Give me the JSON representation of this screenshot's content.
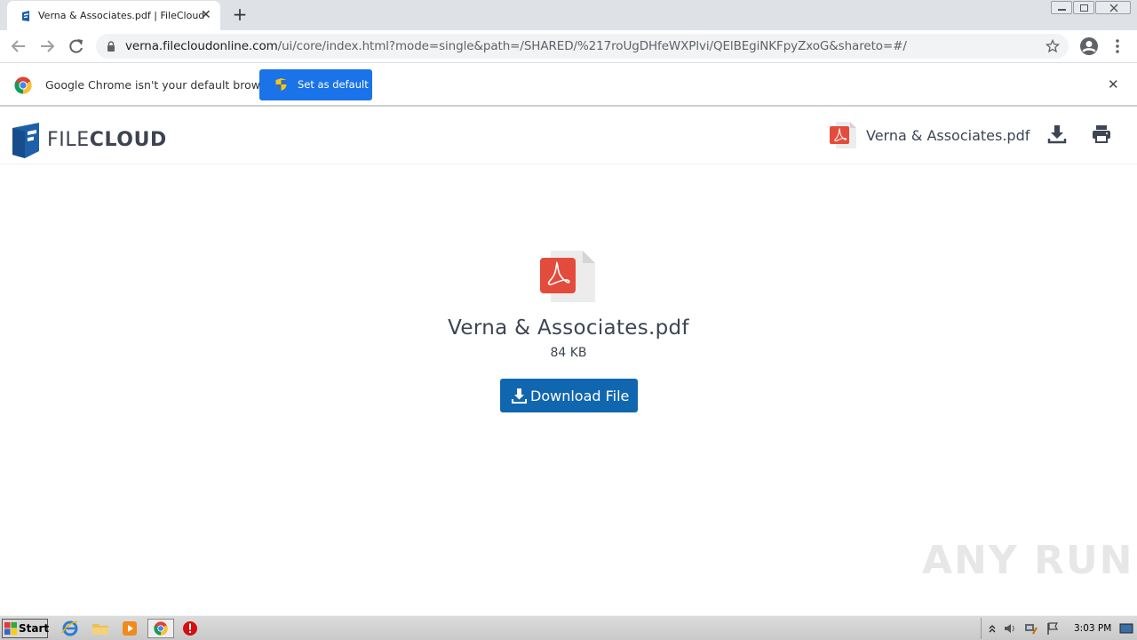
{
  "browser": {
    "tab_title": "Verna & Associates.pdf | FileCloud",
    "tab_close": "✕",
    "new_tab": "+",
    "url_host": "verna.filecloudonline.com",
    "url_path": "/ui/core/index.html?mode=single&path=/SHARED/%217roUgDHfeWXPlvi/QElBEgiNKFpyZxoG&shareto=#/"
  },
  "infobar": {
    "message": "Google Chrome isn't your default browser",
    "set_default_label": "Set as default",
    "close": "✕"
  },
  "header": {
    "logo_light": "FILE",
    "logo_bold": "CLOUD",
    "file_name": "Verna & Associates.pdf"
  },
  "file": {
    "name": "Verna & Associates.pdf",
    "size": "84 KB",
    "download_label": "Download File"
  },
  "watermark": "ANY RUN",
  "taskbar": {
    "start_label": "Start",
    "clock": "3:03 PM"
  },
  "colors": {
    "accent": "#1166b0",
    "pdf_red": "#e34c3c",
    "chrome_blue": "#1a73e8"
  }
}
